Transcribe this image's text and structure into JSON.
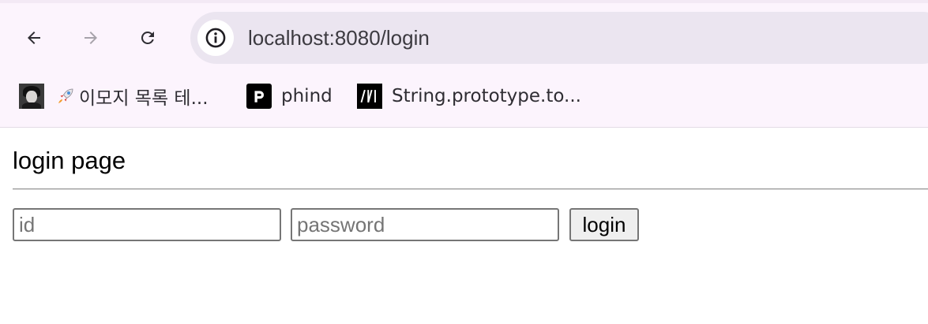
{
  "browser": {
    "url": "localhost:8080/login",
    "bookmarks": [
      {
        "label": "이모지 목록 테...",
        "icon": "avatar-icon"
      },
      {
        "label": "phind",
        "icon": "phind-icon"
      },
      {
        "label": "String.prototype.to...",
        "icon": "mdn-icon"
      }
    ]
  },
  "page": {
    "title": "login page",
    "id_placeholder": "id",
    "password_placeholder": "password",
    "login_label": "login"
  },
  "colors": {
    "chrome_background": "#fcf4fd",
    "omnibox_background": "#ebe5f0"
  }
}
